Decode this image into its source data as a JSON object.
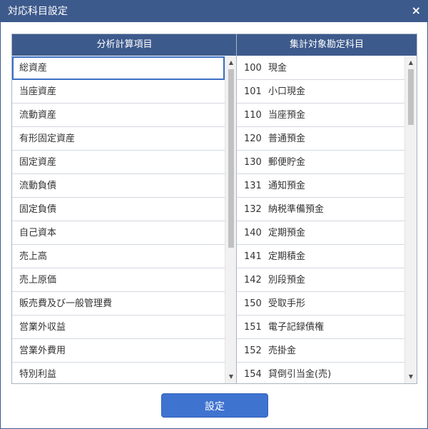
{
  "dialog": {
    "title": "対応科目設定",
    "close_label": "×"
  },
  "left": {
    "header": "分析計算項目",
    "items": [
      "総資産",
      "当座資産",
      "流動資産",
      "有形固定資産",
      "固定資産",
      "流動負債",
      "固定負債",
      "自己資本",
      "売上高",
      "売上原価",
      "販売費及び一般管理費",
      "営業外収益",
      "営業外費用",
      "特別利益"
    ],
    "selected_index": 0
  },
  "right": {
    "header": "集計対象勘定科目",
    "items": [
      {
        "code": "100",
        "name": "現金"
      },
      {
        "code": "101",
        "name": "小口現金"
      },
      {
        "code": "110",
        "name": "当座預金"
      },
      {
        "code": "120",
        "name": "普通預金"
      },
      {
        "code": "130",
        "name": "郵便貯金"
      },
      {
        "code": "131",
        "name": "通知預金"
      },
      {
        "code": "132",
        "name": "納税準備預金"
      },
      {
        "code": "140",
        "name": "定期預金"
      },
      {
        "code": "141",
        "name": "定期積金"
      },
      {
        "code": "142",
        "name": "別段預金"
      },
      {
        "code": "150",
        "name": "受取手形"
      },
      {
        "code": "151",
        "name": "電子記録債権"
      },
      {
        "code": "152",
        "name": "売掛金"
      },
      {
        "code": "154",
        "name": "貸倒引当金(売)"
      }
    ]
  },
  "scroll": {
    "up": "▲",
    "down": "▼"
  },
  "footer": {
    "ok_label": "設定"
  },
  "colors": {
    "accent": "#3d5a8c",
    "button": "#3f73d0",
    "selected_border": "#3d6fc4"
  }
}
